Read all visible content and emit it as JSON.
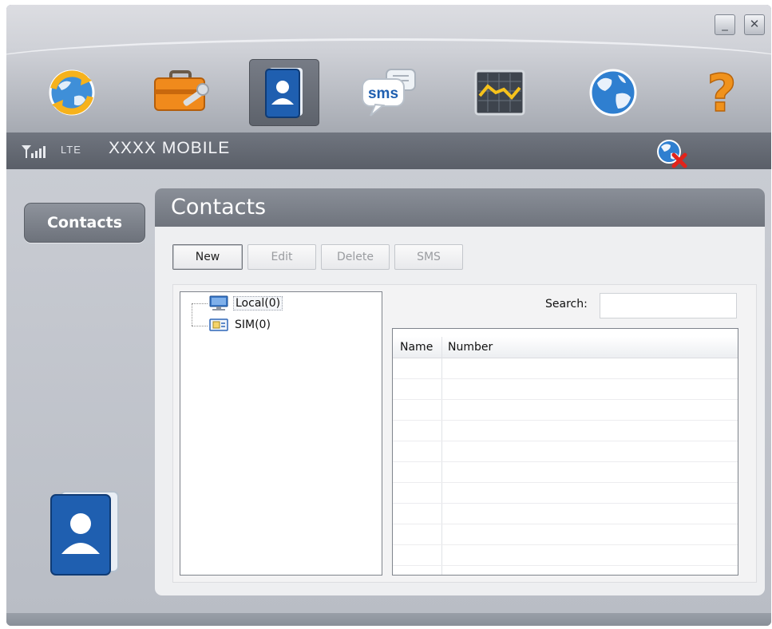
{
  "window": {
    "minimize_glyph": "_",
    "close_glyph": "✕"
  },
  "toolbar": {
    "items": [
      {
        "name": "connect",
        "icon": "globe-refresh-icon"
      },
      {
        "name": "settings",
        "icon": "toolbox-icon"
      },
      {
        "name": "contacts",
        "icon": "contact-book-icon",
        "selected": true
      },
      {
        "name": "sms",
        "icon": "sms-bubble-icon",
        "label": "sms"
      },
      {
        "name": "statistics",
        "icon": "chart-icon"
      },
      {
        "name": "internet",
        "icon": "globe-icon"
      },
      {
        "name": "help",
        "icon": "question-icon",
        "label": "?"
      }
    ]
  },
  "status": {
    "network_type": "LTE",
    "carrier": "XXXX MOBILE",
    "signal_icon": "signal-icon",
    "connection_icon": "disconnected-globe-icon"
  },
  "sidebar": {
    "contacts_label": "Contacts"
  },
  "panel": {
    "title": "Contacts",
    "buttons": {
      "new": "New",
      "edit": "Edit",
      "delete": "Delete",
      "sms": "SMS"
    },
    "tree": {
      "local": "Local(0)",
      "sim": "SIM(0)"
    },
    "search": {
      "label": "Search:",
      "value": ""
    },
    "table": {
      "columns": [
        "Name",
        "Number"
      ],
      "rows": []
    }
  },
  "colors": {
    "accent": "#1f5fb0",
    "statusbar": "#656a73",
    "panel_header": "#7c818a"
  }
}
